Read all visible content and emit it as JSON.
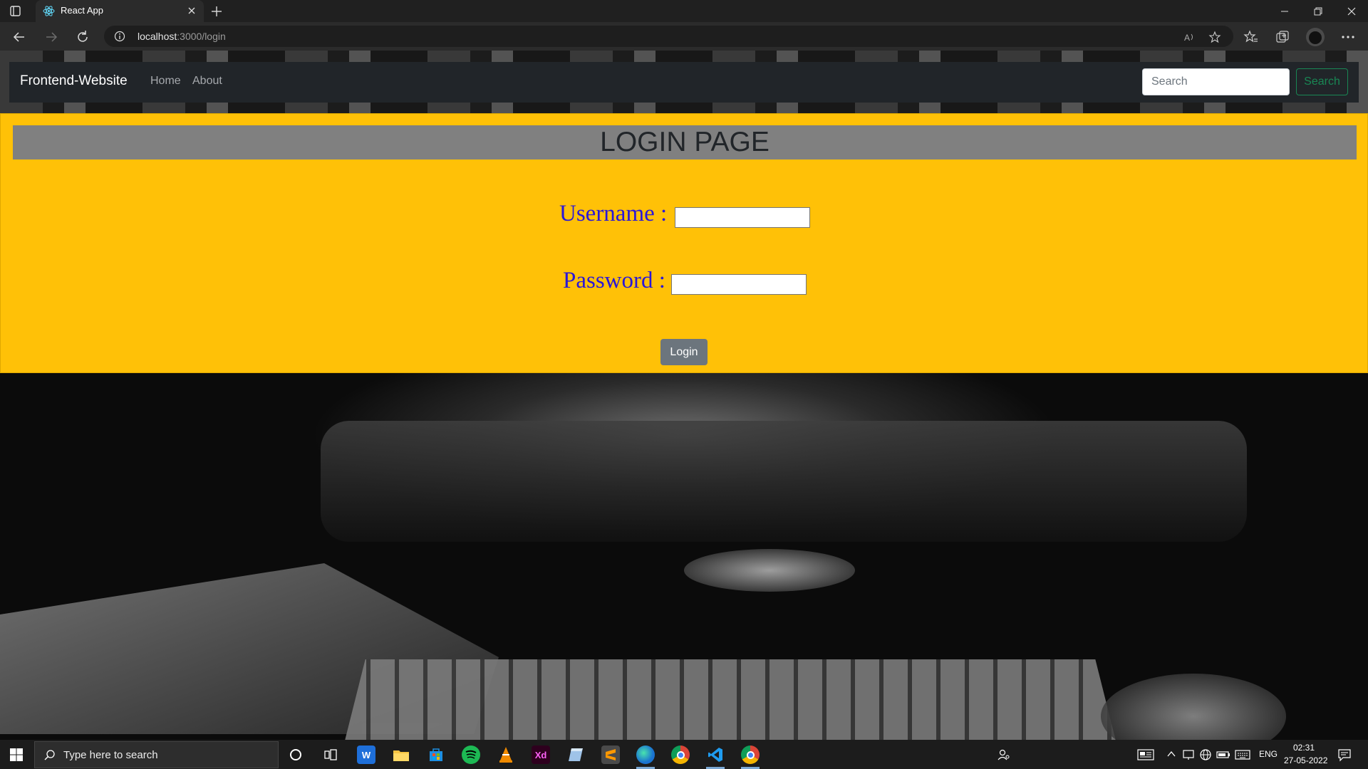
{
  "browser": {
    "tab_title": "React App",
    "url_host": "localhost",
    "url_path": ":3000/login"
  },
  "navbar": {
    "brand": "Frontend-Website",
    "links": [
      "Home",
      "About"
    ],
    "search_placeholder": "Search",
    "search_button": "Search"
  },
  "login": {
    "title": "LOGIN PAGE",
    "username_label": "Username :",
    "password_label": "Password :",
    "button_label": "Login",
    "username_value": "",
    "password_value": ""
  },
  "taskbar": {
    "search_placeholder": "Type here to search",
    "language": "ENG",
    "time": "02:31",
    "date": "27-05-2022",
    "apps": [
      "cortana-icon",
      "task-view-icon",
      "app-blue-icon",
      "file-explorer-icon",
      "store-icon",
      "spotify-icon",
      "vlc-icon",
      "adobe-xd-icon",
      "notes-icon",
      "sublime-text-icon",
      "edge-icon",
      "chrome-icon",
      "vscode-icon",
      "chrome-dev-icon"
    ]
  },
  "colors": {
    "panel": "#ffc107",
    "header_bar": "#808080",
    "label": "#2a17d8",
    "navbar": "#212529",
    "search_button": "#198754",
    "login_button": "#6c757d"
  }
}
